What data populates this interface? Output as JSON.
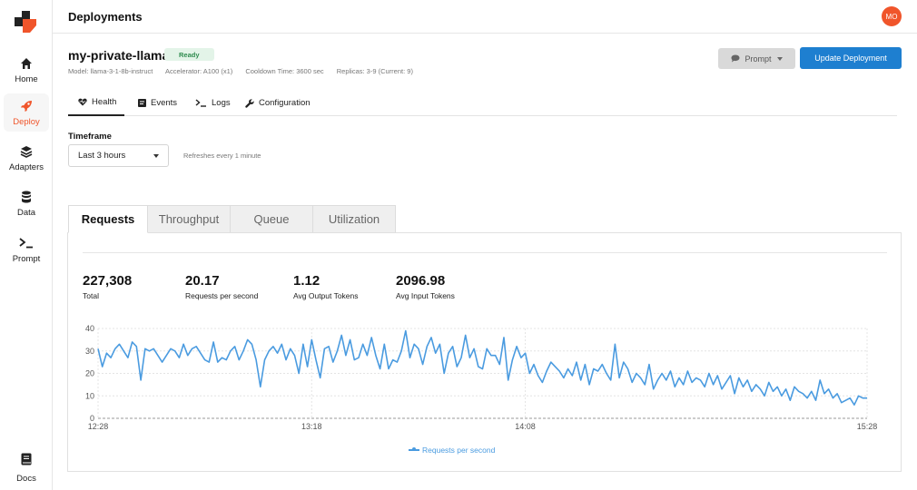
{
  "sidebar": {
    "items": [
      {
        "label": "Home",
        "icon": "home-icon"
      },
      {
        "label": "Deploy",
        "icon": "rocket-icon",
        "active": true
      },
      {
        "label": "Adapters",
        "icon": "layers-icon"
      },
      {
        "label": "Data",
        "icon": "database-icon"
      },
      {
        "label": "Prompt",
        "icon": "terminal-icon"
      }
    ],
    "docs": {
      "label": "Docs",
      "icon": "book-icon"
    }
  },
  "header": {
    "title": "Deployments",
    "avatar_initials": "MO"
  },
  "deployment": {
    "name": "my-private-llama",
    "status": "Ready",
    "model": "Model: llama-3-1-8b-instruct",
    "accelerator": "Accelerator:  A100 (x1)",
    "cooldown": "Cooldown Time: 3600 sec",
    "replicas": "Replicas: 3-9 (Current: 9)"
  },
  "actions": {
    "prompt_label": "Prompt",
    "update_label": "Update Deployment"
  },
  "tabs": [
    {
      "label": "Health",
      "icon": "heart-icon",
      "active": true
    },
    {
      "label": "Events",
      "icon": "events-icon"
    },
    {
      "label": "Logs",
      "icon": "terminal-icon"
    },
    {
      "label": "Configuration",
      "icon": "wrench-icon"
    }
  ],
  "timeframe": {
    "label": "Timeframe",
    "value": "Last 3 hours",
    "refresh_note": "Refreshes every 1 minute"
  },
  "metric_tabs": [
    {
      "label": "Requests",
      "active": true
    },
    {
      "label": "Throughput"
    },
    {
      "label": "Queue"
    },
    {
      "label": "Utilization"
    }
  ],
  "stats": [
    {
      "value": "227,308",
      "label": "Total"
    },
    {
      "value": "20.17",
      "label": "Requests per second"
    },
    {
      "value": "1.12",
      "label": "Avg Output Tokens"
    },
    {
      "value": "2096.98",
      "label": "Avg Input Tokens"
    }
  ],
  "colors": {
    "accent": "#f0552b",
    "primary": "#1e7fd0",
    "series": "#4a9be0",
    "ready_bg": "#e3f4e8"
  },
  "chart_data": {
    "type": "line",
    "xlabel": "",
    "ylabel": "",
    "x_ticks": [
      "12:28",
      "13:18",
      "14:08",
      "15:28"
    ],
    "y_ticks": [
      0,
      10,
      20,
      30,
      40
    ],
    "ylim": [
      0,
      40
    ],
    "xlim_minutes": [
      0,
      180
    ],
    "grid": true,
    "legend_position": "bottom-center",
    "series": [
      {
        "name": "Requests per second",
        "x_minutes": [
          0,
          1,
          2,
          3,
          4,
          5,
          6,
          7,
          8,
          9,
          10,
          11,
          12,
          13,
          14,
          15,
          16,
          17,
          18,
          19,
          20,
          21,
          22,
          23,
          24,
          25,
          26,
          27,
          28,
          29,
          30,
          31,
          32,
          33,
          34,
          35,
          36,
          37,
          38,
          39,
          40,
          41,
          42,
          43,
          44,
          45,
          46,
          47,
          48,
          49,
          50,
          51,
          52,
          53,
          54,
          55,
          56,
          57,
          58,
          59,
          60,
          61,
          62,
          63,
          64,
          65,
          66,
          67,
          68,
          69,
          70,
          71,
          72,
          73,
          74,
          75,
          76,
          77,
          78,
          79,
          80,
          81,
          82,
          83,
          84,
          85,
          86,
          87,
          88,
          89,
          90,
          91,
          92,
          93,
          94,
          95,
          96,
          97,
          98,
          99,
          100,
          101,
          102,
          103,
          104,
          105,
          106,
          107,
          108,
          109,
          110,
          111,
          112,
          113,
          114,
          115,
          116,
          117,
          118,
          119,
          120,
          121,
          122,
          123,
          124,
          125,
          126,
          127,
          128,
          129,
          130,
          131,
          132,
          133,
          134,
          135,
          136,
          137,
          138,
          139,
          140,
          141,
          142,
          143,
          144,
          145,
          146,
          147,
          148,
          149,
          150,
          151,
          152,
          153,
          154,
          155,
          156,
          157,
          158,
          159,
          160,
          161,
          162,
          163,
          164,
          165,
          166,
          167,
          168,
          169,
          170,
          171,
          172,
          173,
          174,
          175,
          176,
          177,
          178,
          179,
          180
        ],
        "values": [
          31,
          23,
          29,
          27,
          31,
          33,
          30,
          27,
          34,
          32,
          17,
          31,
          30,
          31,
          28,
          25,
          28,
          31,
          30,
          27,
          33,
          28,
          31,
          32,
          29,
          26,
          25,
          34,
          25,
          27,
          26,
          30,
          32,
          26,
          30,
          35,
          33,
          26,
          14,
          26,
          30,
          32,
          29,
          33,
          26,
          31,
          28,
          20,
          33,
          23,
          35,
          26,
          18,
          31,
          32,
          25,
          30,
          37,
          28,
          35,
          26,
          27,
          33,
          28,
          36,
          28,
          22,
          33,
          22,
          26,
          25,
          30,
          39,
          27,
          33,
          31,
          24,
          32,
          36,
          29,
          33,
          20,
          29,
          32,
          23,
          27,
          37,
          27,
          31,
          23,
          22,
          31,
          28,
          28,
          24,
          36,
          17,
          26,
          32,
          27,
          29,
          20,
          24,
          19,
          16,
          21,
          25,
          23,
          21,
          18,
          22,
          19,
          25,
          17,
          24,
          15,
          22,
          21,
          24,
          20,
          17,
          33,
          18,
          25,
          22,
          16,
          20,
          18,
          15,
          24,
          13,
          17,
          20,
          17,
          21,
          14,
          18,
          15,
          21,
          16,
          18,
          17,
          14,
          20,
          15,
          19,
          13,
          16,
          19,
          11,
          18,
          14,
          17,
          12,
          15,
          13,
          10,
          16,
          12,
          14,
          10,
          13,
          8,
          14,
          12,
          11,
          9,
          12,
          8,
          17,
          11,
          13,
          9,
          11,
          7,
          8,
          9,
          6,
          10,
          9,
          9
        ]
      }
    ]
  }
}
